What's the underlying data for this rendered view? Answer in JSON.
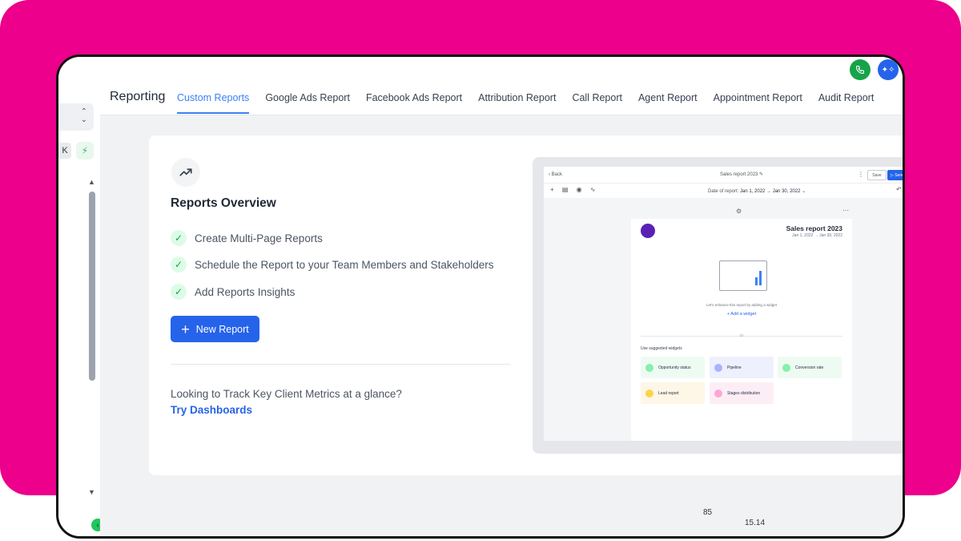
{
  "header": {
    "title": "Reporting",
    "tabs": [
      {
        "label": "Custom Reports",
        "active": true
      },
      {
        "label": "Google Ads Report"
      },
      {
        "label": "Facebook Ads Report"
      },
      {
        "label": "Attribution Report"
      },
      {
        "label": "Call Report"
      },
      {
        "label": "Agent Report"
      },
      {
        "label": "Appointment Report"
      },
      {
        "label": "Audit Report"
      }
    ],
    "phone_icon": "phone-icon",
    "ai_icon": "sparkle-icon"
  },
  "sidebar": {
    "kbd_key": "K"
  },
  "overview": {
    "title": "Reports Overview",
    "features": [
      "Create Multi-Page Reports",
      "Schedule the Report to your Team Members and Stakeholders",
      "Add Reports Insights"
    ],
    "new_report_label": "New Report",
    "prompt": "Looking to Track Key Client Metrics at a glance?",
    "link": "Try Dashboards"
  },
  "preview": {
    "back": "Back",
    "report_title": "Sales report 2023",
    "save": "Save",
    "send": "Send",
    "date_label": "Date of report:",
    "date_range": "Jan 1, 2022 → Jan 30, 2022",
    "page_title": "Sales report 2023",
    "page_date": "Jan 1, 2022 → Jan 30, 2022",
    "hint": "Let's enhance this report by adding a widget",
    "add_widget": "+ Add a widget",
    "or": "Or",
    "suggested": "Use suggested widgets",
    "widgets": [
      {
        "label": "Opportunity status",
        "color": "#22c55e",
        "bg": "#eefbf3"
      },
      {
        "label": "Pipeline",
        "color": "#6366f1",
        "bg": "#eef0fd"
      },
      {
        "label": "Conversion rate",
        "color": "#22c55e",
        "bg": "#eefbf3"
      },
      {
        "label": "Lead report",
        "color": "#f59e0b",
        "bg": "#fef6e7"
      },
      {
        "label": "Stages distribution",
        "color": "#ec4899",
        "bg": "#fdeef6"
      }
    ]
  },
  "footer": {
    "num1": "85",
    "num2": "15.14"
  },
  "colors": {
    "brand_pink": "#EC008C",
    "primary": "#2563eb",
    "success": "#16a34a"
  }
}
